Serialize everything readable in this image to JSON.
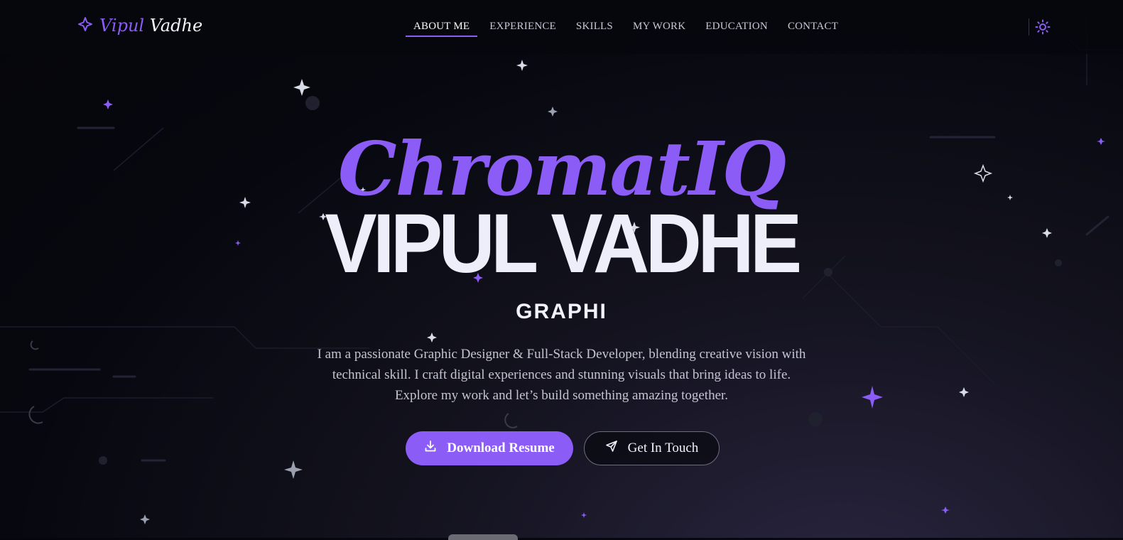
{
  "header": {
    "logo_first": "Vipul",
    "logo_last": "Vadhe",
    "logo_icon": "sparkle-icon",
    "nav_items": [
      "ABOUT ME",
      "EXPERIENCE",
      "SKILLS",
      "MY WORK",
      "EDUCATION",
      "CONTACT"
    ],
    "active_nav": "ABOUT ME",
    "theme_icon": "sun-icon"
  },
  "hero": {
    "brand_script": "ChromatIQ",
    "name": "VIPUL VADHE",
    "role": "GRAPHI",
    "intro_lines": [
      "I am a passionate Graphic Designer & Full-Stack Developer, blending creative vision with",
      "technical skill. I craft digital experiences and stunning visuals that bring ideas to life.",
      "Explore my work and let’s build something amazing together."
    ],
    "primary_button": {
      "label": "Download Resume",
      "icon": "download-icon"
    },
    "secondary_button": {
      "label": "Get In Touch",
      "icon": "send-icon"
    }
  },
  "colors": {
    "accent": "#8b5cf6",
    "background": "#05060b",
    "text": "#eeeefb"
  }
}
